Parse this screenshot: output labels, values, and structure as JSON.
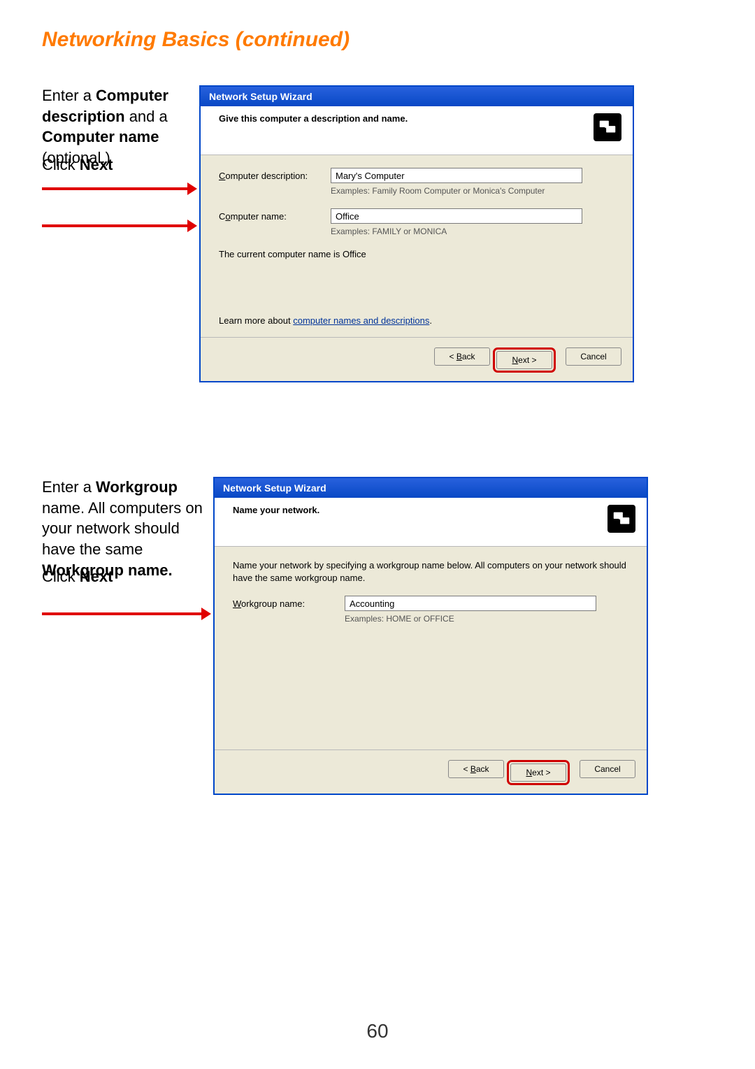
{
  "page": {
    "title": "Networking Basics  (continued)",
    "number": "60"
  },
  "step1": {
    "instruction_prefix": "Enter a ",
    "instruction_b1": "Computer description",
    "instruction_mid": " and a ",
    "instruction_b2": "Computer name",
    "instruction_suffix": " (optional.)",
    "click_prefix": "Click ",
    "click_bold": "Next",
    "wizard_title": "Network Setup Wizard",
    "header_text": "Give this computer a description and name.",
    "desc_label_pre": "C",
    "desc_label_post": "omputer description:",
    "desc_value": "Mary's Computer",
    "desc_examples": "Examples: Family Room Computer or Monica's Computer",
    "name_label_pre": "C",
    "name_label_mid": "o",
    "name_label_post": "mputer name:",
    "name_value": "Office",
    "name_examples": "Examples: FAMILY or MONICA",
    "current_prefix": "The current computer name is  ",
    "current_value": "Office",
    "learn_prefix": "Learn more about ",
    "learn_link": "computer names and descriptions",
    "learn_suffix": ".",
    "back_pre": "< ",
    "back_u": "B",
    "back_post": "ack",
    "next_u": "N",
    "next_post": "ext >",
    "cancel": "Cancel"
  },
  "step2": {
    "instruction_prefix": "Enter a ",
    "instruction_b1": "Workgroup",
    "instruction_mid1": " name.  All computers on your network should have the same ",
    "instruction_b2": "Workgroup name.",
    "click_prefix": "Click ",
    "click_bold": "Next",
    "wizard_title": "Network Setup Wizard",
    "header_text": "Name your network.",
    "body_note": "Name your network by specifying a workgroup name below. All computers on your network should have the same workgroup name.",
    "wg_label_u": "W",
    "wg_label_post": "orkgroup name:",
    "wg_value": "Accounting",
    "wg_examples": "Examples: HOME or OFFICE",
    "back_pre": "< ",
    "back_u": "B",
    "back_post": "ack",
    "next_u": "N",
    "next_post": "ext >",
    "cancel": "Cancel"
  }
}
